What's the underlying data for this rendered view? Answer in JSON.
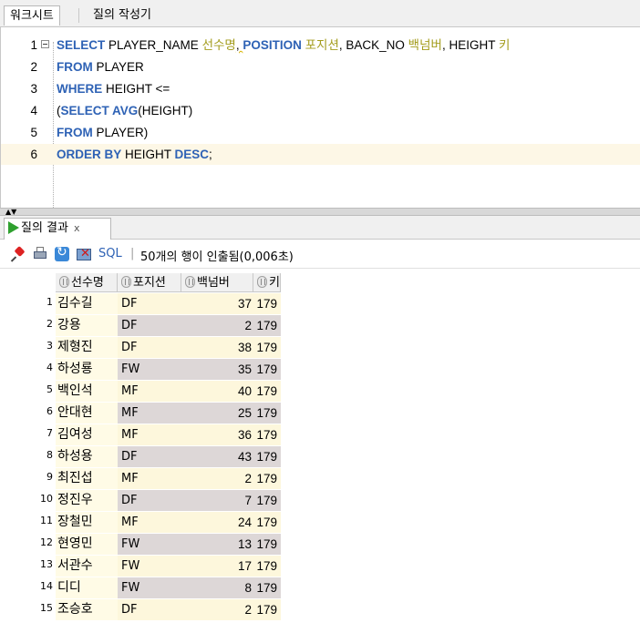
{
  "tabs": {
    "worksheet": "워크시트",
    "query_builder": "질의 작성기"
  },
  "editor": {
    "lines": [
      {
        "num": "1",
        "tokens": [
          [
            "kw",
            "SELECT"
          ],
          [
            "id",
            " PLAYER_NAME "
          ],
          [
            "al",
            "선수명"
          ],
          [
            "id",
            ", "
          ],
          [
            "kw",
            "POSITION"
          ],
          [
            "id",
            " "
          ],
          [
            "al",
            "포지션"
          ],
          [
            "id",
            ", BACK_NO "
          ],
          [
            "al",
            "백넘버"
          ],
          [
            "id",
            ", HEIGHT "
          ],
          [
            "al",
            "키"
          ]
        ]
      },
      {
        "num": "2",
        "tokens": [
          [
            "kw",
            "FROM"
          ],
          [
            "id",
            " PLAYER"
          ]
        ]
      },
      {
        "num": "3",
        "tokens": [
          [
            "kw",
            "WHERE"
          ],
          [
            "id",
            " HEIGHT <="
          ]
        ]
      },
      {
        "num": "4",
        "tokens": [
          [
            "id",
            "("
          ],
          [
            "kw",
            "SELECT AVG"
          ],
          [
            "id",
            "(HEIGHT)"
          ]
        ]
      },
      {
        "num": "5",
        "tokens": [
          [
            "kw",
            "FROM"
          ],
          [
            "id",
            " PLAYER)"
          ]
        ]
      },
      {
        "num": "6",
        "tokens": [
          [
            "kw",
            "ORDER BY"
          ],
          [
            "id",
            " HEIGHT "
          ],
          [
            "kw",
            "DESC"
          ],
          [
            "id",
            ";"
          ]
        ]
      }
    ]
  },
  "results_tab": {
    "label": "질의 결과",
    "close": "x"
  },
  "toolbar": {
    "sql_label": "SQL",
    "separator": "|",
    "status": "50개의 행이 인출됨(0,006초)"
  },
  "grid": {
    "columns": [
      "선수명",
      "포지션",
      "백넘버",
      "키"
    ],
    "rows": [
      [
        "1",
        "김수길",
        "DF",
        "37",
        "179"
      ],
      [
        "2",
        "강용",
        "DF",
        "2",
        "179"
      ],
      [
        "3",
        "제형진",
        "DF",
        "38",
        "179"
      ],
      [
        "4",
        "하성룡",
        "FW",
        "35",
        "179"
      ],
      [
        "5",
        "백인석",
        "MF",
        "40",
        "179"
      ],
      [
        "6",
        "안대현",
        "MF",
        "25",
        "179"
      ],
      [
        "7",
        "김여성",
        "MF",
        "36",
        "179"
      ],
      [
        "8",
        "하성용",
        "DF",
        "43",
        "179"
      ],
      [
        "9",
        "최진섭",
        "MF",
        "2",
        "179"
      ],
      [
        "10",
        "정진우",
        "DF",
        "7",
        "179"
      ],
      [
        "11",
        "장철민",
        "MF",
        "24",
        "179"
      ],
      [
        "12",
        "현영민",
        "FW",
        "13",
        "179"
      ],
      [
        "13",
        "서관수",
        "FW",
        "17",
        "179"
      ],
      [
        "14",
        "디디",
        "FW",
        "8",
        "179"
      ],
      [
        "15",
        "조승호",
        "DF",
        "2",
        "179"
      ]
    ]
  }
}
